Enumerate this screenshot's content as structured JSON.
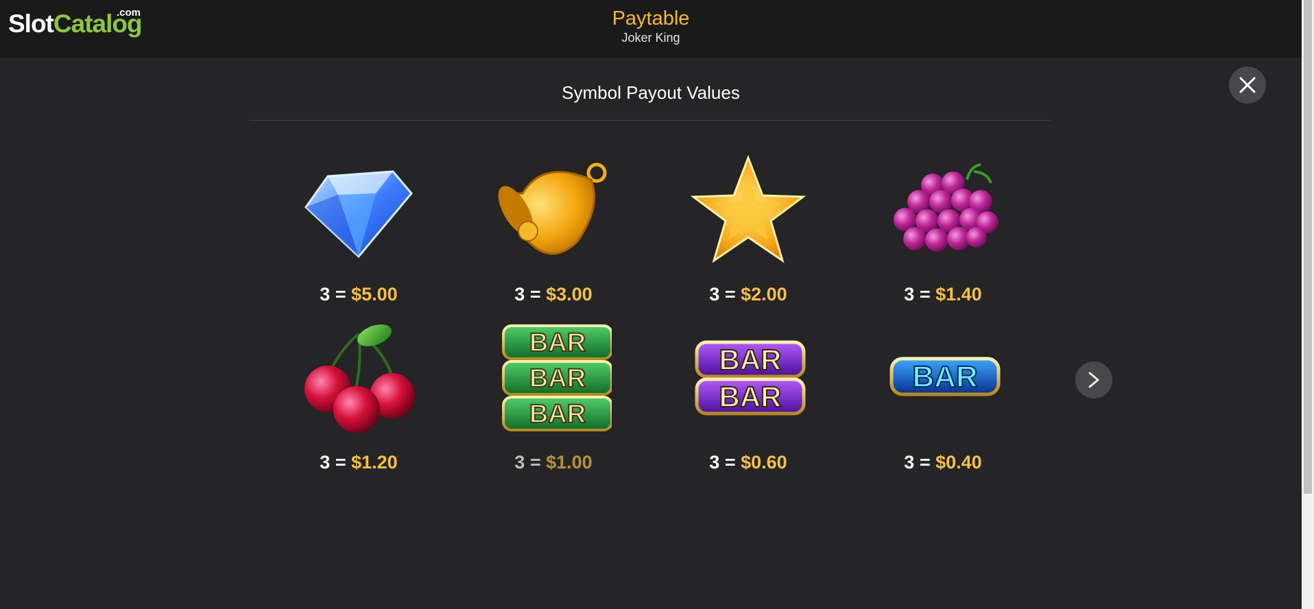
{
  "header": {
    "logo_slot": "Slot",
    "logo_catalog": "Catalog",
    "logo_com": ".com",
    "title": "Paytable",
    "subtitle": "Joker King"
  },
  "section": {
    "title": "Symbol Payout Values"
  },
  "colors": {
    "accent": "#f6b92b",
    "value": "#f6c144",
    "background": "#252426"
  },
  "symbols": [
    {
      "icon": "diamond-icon",
      "count": "3 =",
      "value": "$5.00"
    },
    {
      "icon": "bell-icon",
      "count": "3 =",
      "value": "$3.00"
    },
    {
      "icon": "star-icon",
      "count": "3 =",
      "value": "$2.00"
    },
    {
      "icon": "grapes-icon",
      "count": "3 =",
      "value": "$1.40"
    },
    {
      "icon": "cherries-icon",
      "count": "3 =",
      "value": "$1.20"
    },
    {
      "icon": "triple-bar-icon",
      "count": "3 =",
      "value": "$1.00"
    },
    {
      "icon": "double-bar-icon",
      "count": "3 =",
      "value": "$0.60"
    },
    {
      "icon": "single-bar-icon",
      "count": "3 =",
      "value": "$0.40"
    }
  ],
  "controls": {
    "close_icon": "close-icon",
    "next_icon": "chevron-right-icon",
    "bar_text": "BAR"
  }
}
